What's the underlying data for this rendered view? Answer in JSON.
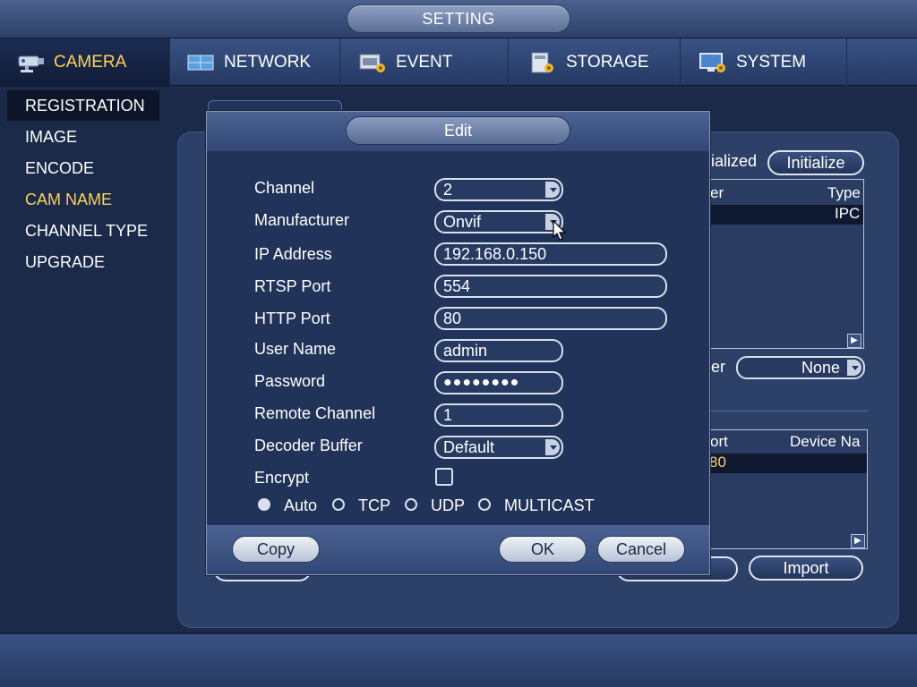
{
  "header": {
    "title": "SETTING"
  },
  "tabs": [
    {
      "label": "CAMERA",
      "icon": "camera-icon",
      "active": true
    },
    {
      "label": "NETWORK",
      "icon": "network-icon"
    },
    {
      "label": "EVENT",
      "icon": "event-icon"
    },
    {
      "label": "STORAGE",
      "icon": "storage-icon"
    },
    {
      "label": "SYSTEM",
      "icon": "system-icon"
    }
  ],
  "sidebar": {
    "items": [
      {
        "label": "REGISTRATION"
      },
      {
        "label": "IMAGE"
      },
      {
        "label": "ENCODE"
      },
      {
        "label": "CAM NAME"
      },
      {
        "label": "CHANNEL TYPE"
      },
      {
        "label": "UPGRADE"
      }
    ]
  },
  "background": {
    "initialized_text": "ialized",
    "initialize_button": "Initialize",
    "list1_col_partial": "er",
    "list1_col_type": "Type",
    "list1_row_value": "IPC",
    "filter_label_partial": "er",
    "filter_value": "None",
    "list2_col_port": "ort",
    "list2_col_device": "Device Na",
    "list2_row_port": "80",
    "import_button": "Import"
  },
  "dialog": {
    "title": "Edit",
    "channel_label": "Channel",
    "channel_value": "2",
    "manufacturer_label": "Manufacturer",
    "manufacturer_value": "Onvif",
    "ip_label": "IP Address",
    "ip_value": "192.168.0.150",
    "rtsp_label": "RTSP Port",
    "rtsp_value": "554",
    "http_label": "HTTP Port",
    "http_value": "80",
    "user_label": "User Name",
    "user_value": "admin",
    "password_label": "Password",
    "password_value": "●●●●●●●●",
    "remote_label": "Remote Channel",
    "remote_value": "1",
    "decoder_label": "Decoder Buffer",
    "decoder_value": "Default",
    "encrypt_label": "Encrypt",
    "protocols": [
      "Auto",
      "TCP",
      "UDP",
      "MULTICAST"
    ],
    "selected_protocol": "Auto",
    "copy_button": "Copy",
    "ok_button": "OK",
    "cancel_button": "Cancel"
  }
}
